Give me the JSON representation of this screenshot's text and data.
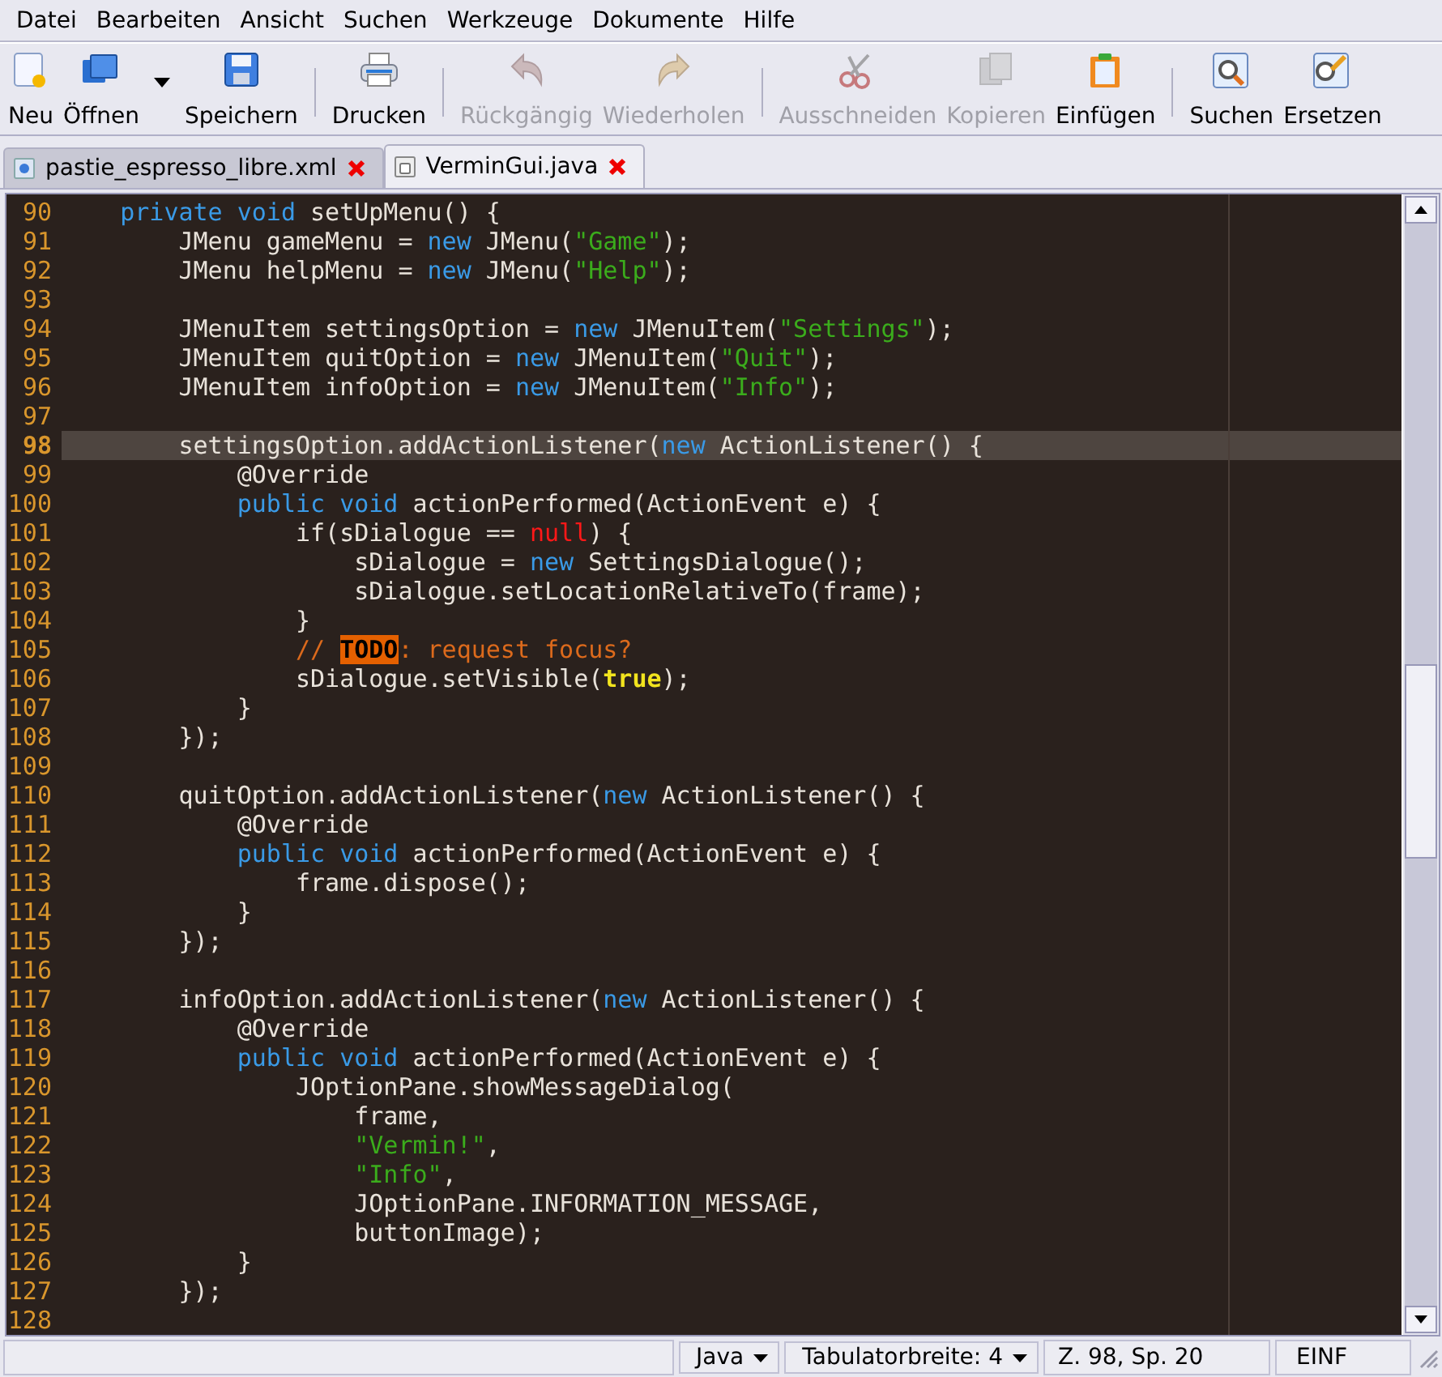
{
  "menu_bar": [
    {
      "label": "Datei"
    },
    {
      "label": "Bearbeiten"
    },
    {
      "label": "Ansicht"
    },
    {
      "label": "Suchen"
    },
    {
      "label": "Werkzeuge"
    },
    {
      "label": "Dokumente"
    },
    {
      "label": "Hilfe"
    }
  ],
  "toolbar": {
    "groups": [
      [
        {
          "label": "Neu",
          "disabled": false
        },
        {
          "label": "Öffnen",
          "disabled": false,
          "has_menu": true
        },
        {
          "label": "Speichern",
          "disabled": false
        }
      ],
      [
        {
          "label": "Drucken",
          "disabled": false
        }
      ],
      [
        {
          "label": "Rückgängig",
          "disabled": true
        },
        {
          "label": "Wiederholen",
          "disabled": true
        }
      ],
      [
        {
          "label": "Ausschneiden",
          "disabled": true
        },
        {
          "label": "Kopieren",
          "disabled": true
        },
        {
          "label": "Einfügen",
          "disabled": false
        }
      ],
      [
        {
          "label": "Suchen",
          "disabled": false
        },
        {
          "label": "Ersetzen",
          "disabled": false
        }
      ]
    ]
  },
  "tabs": [
    {
      "label": "pastie_espresso_libre.xml",
      "selected": false
    },
    {
      "label": "VerminGui.java",
      "selected": true
    }
  ],
  "editor": {
    "lines": [
      {
        "number": "90",
        "current": false,
        "tokens": [
          {
            "kind": "keyword",
            "text": "    private "
          },
          {
            "kind": "keyword",
            "text": "void"
          },
          {
            "kind": "plain",
            "text": " setUpMenu() {"
          }
        ]
      },
      {
        "number": "91",
        "current": false,
        "tokens": [
          {
            "kind": "plain",
            "text": "        JMenu gameMenu = "
          },
          {
            "kind": "keyword",
            "text": "new"
          },
          {
            "kind": "plain",
            "text": " JMenu("
          },
          {
            "kind": "string",
            "text": "\"Game\""
          },
          {
            "kind": "plain",
            "text": ");"
          }
        ]
      },
      {
        "number": "92",
        "current": false,
        "tokens": [
          {
            "kind": "plain",
            "text": "        JMenu helpMenu = "
          },
          {
            "kind": "keyword",
            "text": "new"
          },
          {
            "kind": "plain",
            "text": " JMenu("
          },
          {
            "kind": "string",
            "text": "\"Help\""
          },
          {
            "kind": "plain",
            "text": ");"
          }
        ]
      },
      {
        "number": "93",
        "current": false
      },
      {
        "number": "94",
        "current": false,
        "tokens": [
          {
            "kind": "plain",
            "text": "        JMenuItem settingsOption = "
          },
          {
            "kind": "keyword",
            "text": "new"
          },
          {
            "kind": "plain",
            "text": " JMenuItem("
          },
          {
            "kind": "string",
            "text": "\"Settings\""
          },
          {
            "kind": "plain",
            "text": ");"
          }
        ]
      },
      {
        "number": "95",
        "current": false,
        "tokens": [
          {
            "kind": "plain",
            "text": "        JMenuItem quitOption = "
          },
          {
            "kind": "keyword",
            "text": "new"
          },
          {
            "kind": "plain",
            "text": " JMenuItem("
          },
          {
            "kind": "string",
            "text": "\"Quit\""
          },
          {
            "kind": "plain",
            "text": ");"
          }
        ]
      },
      {
        "number": "96",
        "current": false,
        "tokens": [
          {
            "kind": "plain",
            "text": "        JMenuItem infoOption = "
          },
          {
            "kind": "keyword",
            "text": "new"
          },
          {
            "kind": "plain",
            "text": " JMenuItem("
          },
          {
            "kind": "string",
            "text": "\"Info\""
          },
          {
            "kind": "plain",
            "text": ");"
          }
        ]
      },
      {
        "number": "97",
        "current": false
      },
      {
        "number": "98",
        "current": true,
        "tokens": [
          {
            "kind": "plain",
            "text": "        settingsOption.addActionListener("
          },
          {
            "kind": "keyword",
            "text": "new"
          },
          {
            "kind": "plain",
            "text": " ActionListener() {"
          }
        ]
      },
      {
        "number": "99",
        "current": false,
        "tokens": [
          {
            "kind": "plain",
            "text": "            @Override"
          }
        ]
      },
      {
        "number": "100",
        "current": false,
        "tokens": [
          {
            "kind": "keyword",
            "text": "            public "
          },
          {
            "kind": "keyword",
            "text": "void"
          },
          {
            "kind": "plain",
            "text": " actionPerformed(ActionEvent e) {"
          }
        ]
      },
      {
        "number": "101",
        "current": false,
        "tokens": [
          {
            "kind": "plain",
            "text": "                if(sDialogue == "
          },
          {
            "kind": "null",
            "text": "null"
          },
          {
            "kind": "plain",
            "text": ") {"
          }
        ]
      },
      {
        "number": "102",
        "current": false,
        "tokens": [
          {
            "kind": "plain",
            "text": "                    sDialogue = "
          },
          {
            "kind": "keyword",
            "text": "new"
          },
          {
            "kind": "plain",
            "text": " SettingsDialogue();"
          }
        ]
      },
      {
        "number": "103",
        "current": false,
        "tokens": [
          {
            "kind": "plain",
            "text": "                    sDialogue.setLocationRelativeTo(frame);"
          }
        ]
      },
      {
        "number": "104",
        "current": false,
        "tokens": [
          {
            "kind": "plain",
            "text": "                }"
          }
        ]
      },
      {
        "number": "105",
        "current": false,
        "tokens": [
          {
            "kind": "comment",
            "text": "                // "
          },
          {
            "kind": "todo",
            "text": "TODO"
          },
          {
            "kind": "comment",
            "text": ": request focus?"
          }
        ]
      },
      {
        "number": "106",
        "current": false,
        "tokens": [
          {
            "kind": "plain",
            "text": "                sDialogue.setVisible("
          },
          {
            "kind": "boolean",
            "text": "true"
          },
          {
            "kind": "plain",
            "text": ");"
          }
        ]
      },
      {
        "number": "107",
        "current": false,
        "tokens": [
          {
            "kind": "plain",
            "text": "            }"
          }
        ]
      },
      {
        "number": "108",
        "current": false,
        "tokens": [
          {
            "kind": "plain",
            "text": "        });"
          }
        ]
      },
      {
        "number": "109",
        "current": false
      },
      {
        "number": "110",
        "current": false,
        "tokens": [
          {
            "kind": "plain",
            "text": "        quitOption.addActionListener("
          },
          {
            "kind": "keyword",
            "text": "new"
          },
          {
            "kind": "plain",
            "text": " ActionListener() {"
          }
        ]
      },
      {
        "number": "111",
        "current": false,
        "tokens": [
          {
            "kind": "plain",
            "text": "            @Override"
          }
        ]
      },
      {
        "number": "112",
        "current": false,
        "tokens": [
          {
            "kind": "keyword",
            "text": "            public "
          },
          {
            "kind": "keyword",
            "text": "void"
          },
          {
            "kind": "plain",
            "text": " actionPerformed(ActionEvent e) {"
          }
        ]
      },
      {
        "number": "113",
        "current": false,
        "tokens": [
          {
            "kind": "plain",
            "text": "                frame.dispose();"
          }
        ]
      },
      {
        "number": "114",
        "current": false,
        "tokens": [
          {
            "kind": "plain",
            "text": "            }"
          }
        ]
      },
      {
        "number": "115",
        "current": false,
        "tokens": [
          {
            "kind": "plain",
            "text": "        });"
          }
        ]
      },
      {
        "number": "116",
        "current": false
      },
      {
        "number": "117",
        "current": false,
        "tokens": [
          {
            "kind": "plain",
            "text": "        infoOption.addActionListener("
          },
          {
            "kind": "keyword",
            "text": "new"
          },
          {
            "kind": "plain",
            "text": " ActionListener() {"
          }
        ]
      },
      {
        "number": "118",
        "current": false,
        "tokens": [
          {
            "kind": "plain",
            "text": "            @Override"
          }
        ]
      },
      {
        "number": "119",
        "current": false,
        "tokens": [
          {
            "kind": "keyword",
            "text": "            public "
          },
          {
            "kind": "keyword",
            "text": "void"
          },
          {
            "kind": "plain",
            "text": " actionPerformed(ActionEvent e) {"
          }
        ]
      },
      {
        "number": "120",
        "current": false,
        "tokens": [
          {
            "kind": "plain",
            "text": "                JOptionPane.showMessageDialog("
          }
        ]
      },
      {
        "number": "121",
        "current": false,
        "tokens": [
          {
            "kind": "plain",
            "text": "                    frame,"
          }
        ]
      },
      {
        "number": "122",
        "current": false,
        "tokens": [
          {
            "kind": "string",
            "text": "                    \"Vermin!\""
          },
          {
            "kind": "plain",
            "text": ","
          }
        ]
      },
      {
        "number": "123",
        "current": false,
        "tokens": [
          {
            "kind": "string",
            "text": "                    \"Info\""
          },
          {
            "kind": "plain",
            "text": ","
          }
        ]
      },
      {
        "number": "124",
        "current": false,
        "tokens": [
          {
            "kind": "plain",
            "text": "                    JOptionPane.INFORMATION_MESSAGE,"
          }
        ]
      },
      {
        "number": "125",
        "current": false,
        "tokens": [
          {
            "kind": "plain",
            "text": "                    buttonImage);"
          }
        ]
      },
      {
        "number": "126",
        "current": false,
        "tokens": [
          {
            "kind": "plain",
            "text": "            }"
          }
        ]
      },
      {
        "number": "127",
        "current": false,
        "tokens": [
          {
            "kind": "plain",
            "text": "        });"
          }
        ]
      },
      {
        "number": "128",
        "current": false
      }
    ]
  },
  "status_bar": {
    "language": "Java",
    "tab_width": "Tabulatorbreite: 4",
    "position": "Z. 98, Sp. 20",
    "mode": "EINF"
  }
}
